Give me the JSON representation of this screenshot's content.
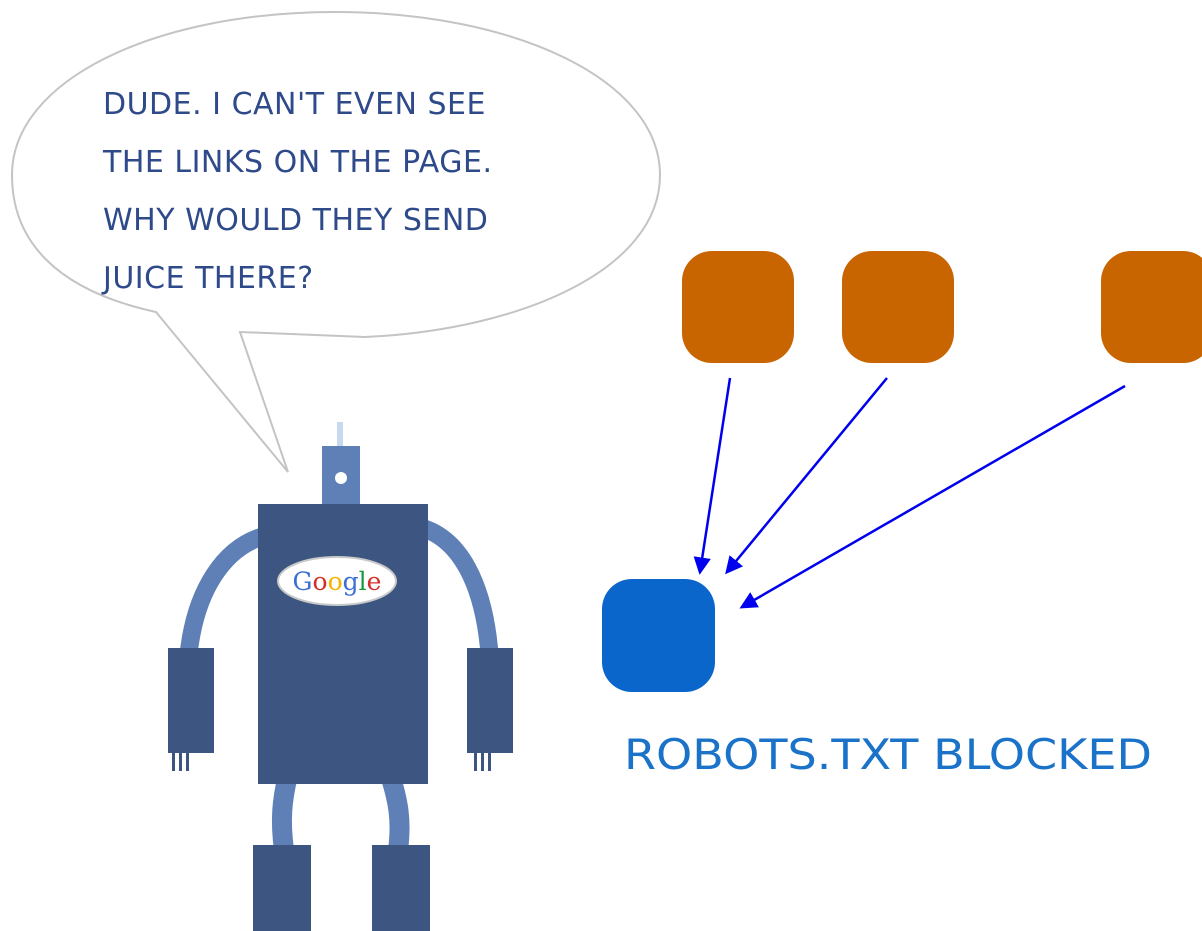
{
  "speech_bubble": {
    "lines": [
      "DUDE. I CAN'T EVEN SEE",
      "THE LINKS ON THE PAGE.",
      "WHY WOULD THEY SEND",
      "JUICE THERE?"
    ]
  },
  "robot": {
    "badge": {
      "letters": [
        "G",
        "o",
        "o",
        "g",
        "l",
        "e"
      ],
      "letter_colors": [
        "#3b6fd4",
        "#d4302a",
        "#f4b400",
        "#3b6fd4",
        "#1a9a3f",
        "#d4302a"
      ]
    }
  },
  "diagram": {
    "blocked_label": "ROBOTS.TXT BLOCKED"
  },
  "colors": {
    "robot_body": "#3d5681",
    "robot_limb": "#5f80b6",
    "source_node": "#c96500",
    "target_node": "#0b66cc",
    "arrow": "#0000ee",
    "bubble_stroke": "#c4c4c4",
    "bubble_text": "#2e4a8a",
    "label_text": "#1a73c8"
  }
}
